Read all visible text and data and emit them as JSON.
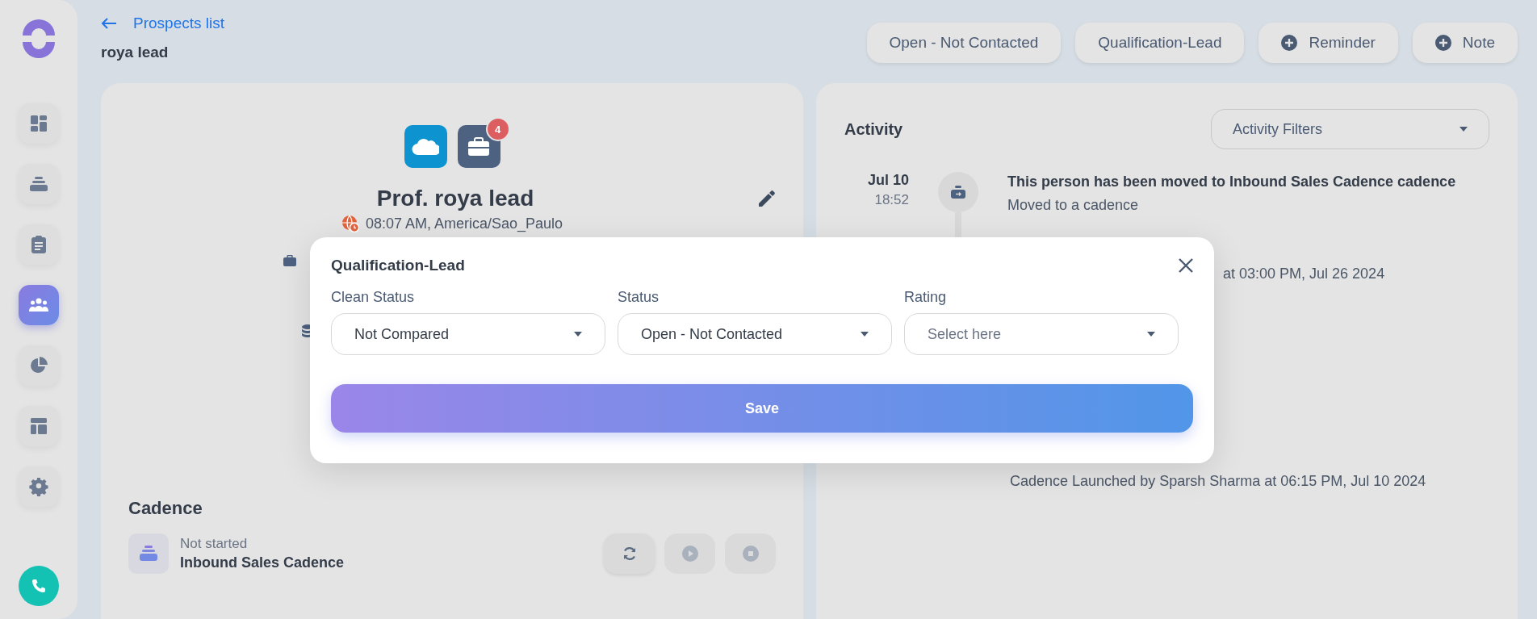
{
  "sidebar": {
    "items": [
      {
        "kind": "dashboard",
        "selected": false
      },
      {
        "kind": "stack",
        "selected": false
      },
      {
        "kind": "clipboard",
        "selected": false
      },
      {
        "kind": "people",
        "selected": true
      },
      {
        "kind": "pie",
        "selected": false
      },
      {
        "kind": "layout",
        "selected": false
      },
      {
        "kind": "settings",
        "selected": false
      }
    ]
  },
  "header": {
    "back_link": "Prospects list",
    "title": "roya lead"
  },
  "actions": [
    {
      "label": "Open - Not Contacted",
      "kind": "plain"
    },
    {
      "label": "Qualification-Lead",
      "kind": "plain"
    },
    {
      "label": "Reminder",
      "kind": "add"
    },
    {
      "label": "Note",
      "kind": "add"
    }
  ],
  "profile": {
    "badge": "4",
    "name": "Prof. roya lead",
    "local_time": "08:07 AM, America/Sao_Paulo"
  },
  "cadence": {
    "heading": "Cadence",
    "status": "Not started",
    "name": "Inbound Sales Cadence",
    "controls": [
      {
        "kind": "refresh",
        "disabled": false
      },
      {
        "kind": "play",
        "disabled": true
      },
      {
        "kind": "stop",
        "disabled": true
      }
    ]
  },
  "activity": {
    "heading": "Activity",
    "filter": {
      "placeholder": "Activity Filters"
    },
    "items": [
      {
        "kind": "event",
        "date": "Jul 10",
        "time": "18:52",
        "title": "This person has been moved to Inbound Sales Cadence cadence",
        "subtitle": "Moved to a cadence"
      },
      {
        "kind": "fragment",
        "text": "at 03:00 PM, Jul 26 2024"
      },
      {
        "kind": "line",
        "text": "Cadence Launched by Sparsh Sharma at 06:15 PM, Jul 10 2024"
      }
    ]
  },
  "modal": {
    "title": "Qualification-Lead",
    "fields": [
      {
        "label": "Clean Status",
        "value": "Not Compared"
      },
      {
        "label": "Status",
        "value": "Open - Not Contacted"
      },
      {
        "label": "Rating",
        "placeholder": "Select here"
      }
    ],
    "save": "Save"
  }
}
